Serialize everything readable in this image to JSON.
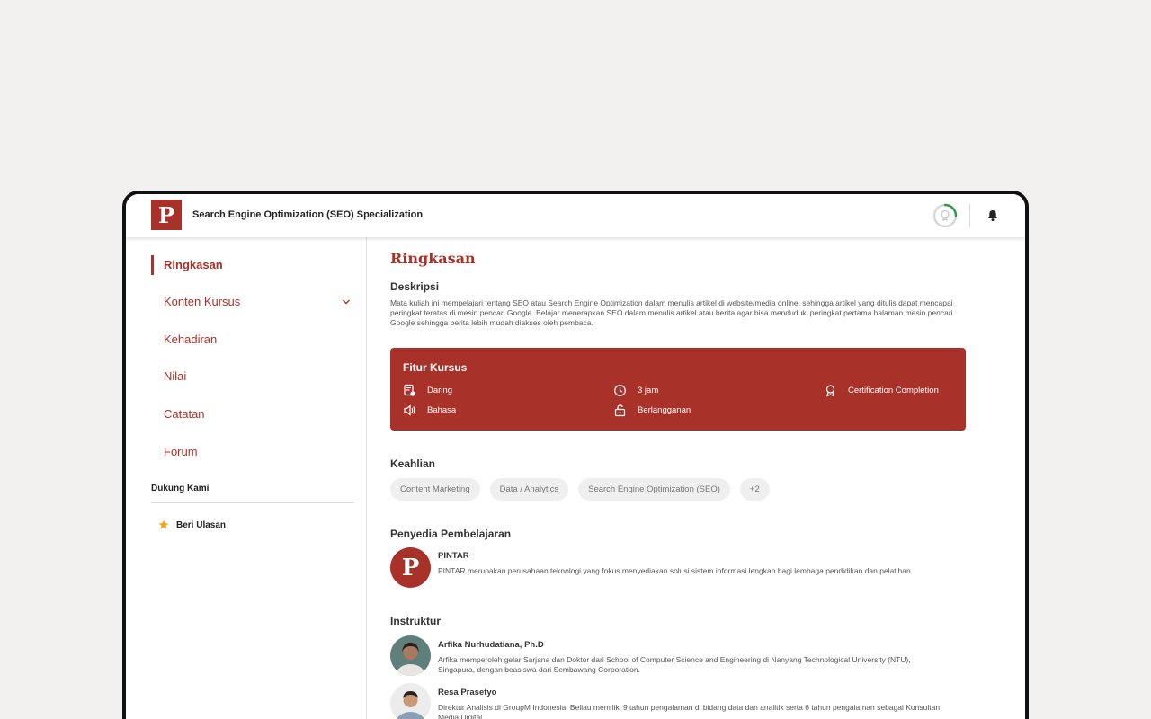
{
  "app": {
    "logo_letter": "P",
    "title": "Search Engine Optimization (SEO) Specialization"
  },
  "header": {
    "progress_percent": 25,
    "accent": "#a8312a",
    "progress_color": "#2e9a4a"
  },
  "sidebar": {
    "items": [
      {
        "label": "Ringkasan"
      },
      {
        "label": "Konten Kursus"
      },
      {
        "label": "Kehadiran"
      },
      {
        "label": "Nilai"
      },
      {
        "label": "Catatan"
      },
      {
        "label": "Forum"
      }
    ],
    "support_title": "Dukung Kami",
    "review_label": "Beri Ulasan"
  },
  "main": {
    "title": "Ringkasan",
    "description_heading": "Deskripsi",
    "description": "Mata kuliah ini mempelajari tentang SEO atau Search Engine Optimization dalam menulis artikel di website/media online, sehingga artikel yang ditulis dapat mencapai peringkat teratas di mesin pencari Google. Belajar menerapkan SEO dalam menulis artikel atau berita agar bisa menduduki peringkat pertama halaman mesin pencari Google sehingga berita lebih mudah diakses oleh pembaca.",
    "features": {
      "title": "Fitur Kursus",
      "mode": "Daring",
      "duration": "3 jam",
      "certificate": "Certification Completion",
      "language": "Bahasa",
      "access": "Berlangganan"
    },
    "skills_heading": "Keahlian",
    "skills": [
      "Content Marketing",
      "Data / Analytics",
      "Search Engine Optimization (SEO)",
      "+2"
    ],
    "provider_heading": "Penyedia Pembelajaran",
    "provider": {
      "logo_letter": "P",
      "name": "PINTAR",
      "description": "PINTAR merupakan perusahaan teknologi yang fokus menyediakan solusi sistem informasi lengkap bagi lembaga pendidikan dan pelatihan."
    },
    "instructor_heading": "Instruktur",
    "instructors": [
      {
        "name": "Arfika Nurhudatiana, Ph.D",
        "description": "Arfika memperoleh gelar Sarjana dan Doktor dari School of Computer Science and Engineering di Nanyang Technological University (NTU), Singapura, dengan beasiswa dari Sembawang Corporation."
      },
      {
        "name": "Resa Prasetyo",
        "description": "Direktur Analisis di GroupM Indonesia. Beliau memiliki 9 tahun pengalaman di bidang data dan analitik serta 6 tahun pengalaman sebagai Konsultan Media Digital."
      }
    ]
  }
}
